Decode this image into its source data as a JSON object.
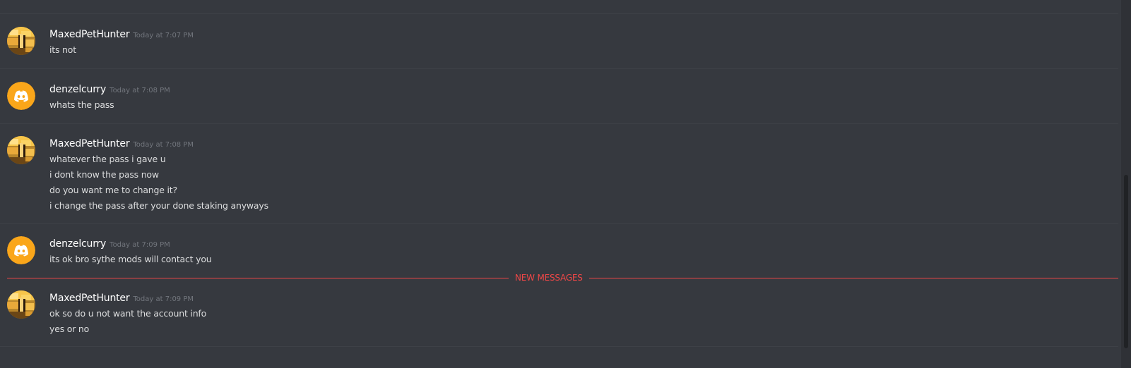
{
  "chat": {
    "new_messages_label": "NEW MESSAGES",
    "messages": [
      {
        "username": "MaxedPetHunter",
        "timestamp": "Today at 7:07 PM",
        "avatar_icon": "gold-bars-icon",
        "lines": [
          "its not"
        ]
      },
      {
        "username": "denzelcurry",
        "timestamp": "Today at 7:08 PM",
        "avatar_icon": "discord-logo-icon",
        "lines": [
          "whats the pass"
        ]
      },
      {
        "username": "MaxedPetHunter",
        "timestamp": "Today at 7:08 PM",
        "avatar_icon": "gold-bars-icon",
        "lines": [
          "whatever the pass i gave u",
          "i dont know the pass now",
          "do you want me to change it?",
          "i change the pass after your done staking anyways"
        ]
      },
      {
        "username": "denzelcurry",
        "timestamp": "Today at 7:09 PM",
        "avatar_icon": "discord-logo-icon",
        "lines": [
          "its ok  bro sythe mods will contact you"
        ]
      },
      {
        "username": "MaxedPetHunter",
        "timestamp": "Today at 7:09 PM",
        "avatar_icon": "gold-bars-icon",
        "lines": [
          "ok so do u not want the account info",
          "yes or no"
        ]
      }
    ]
  },
  "colors": {
    "background": "#36393f",
    "username": "#ffffff",
    "message_text": "#dcddde",
    "timestamp": "#72767d",
    "new_messages": "#f04747",
    "discord_avatar_bg": "#faa61a"
  }
}
